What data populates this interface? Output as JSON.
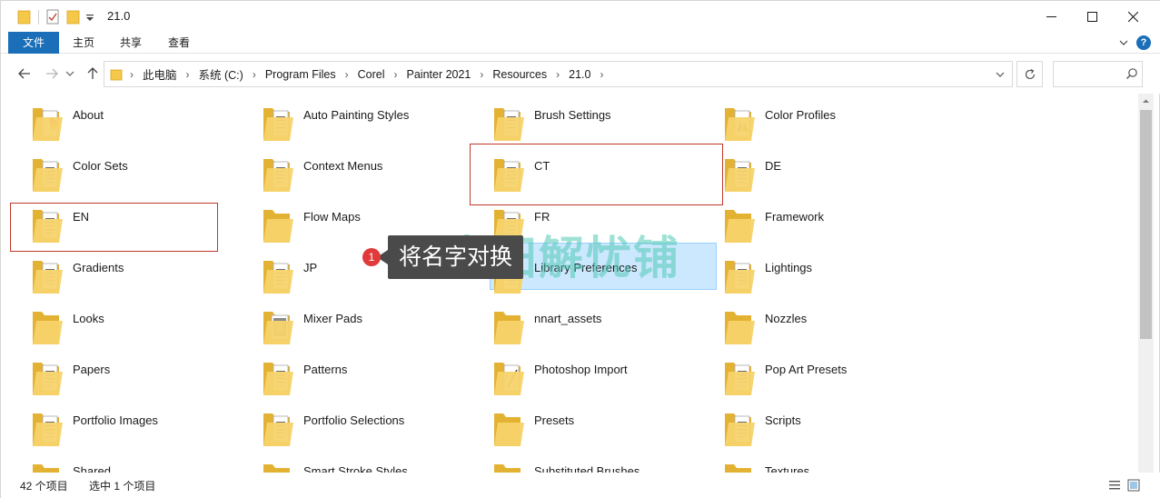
{
  "window": {
    "title": "21.0"
  },
  "ribbon": {
    "tabs": [
      "文件",
      "主页",
      "共享",
      "查看"
    ],
    "help_label": "?"
  },
  "address": {
    "crumbs": [
      "此电脑",
      "系统 (C:)",
      "Program Files",
      "Corel",
      "Painter 2021",
      "Resources",
      "21.0"
    ]
  },
  "search": {
    "placeholder": ""
  },
  "items": [
    {
      "label": "About",
      "icon": "folder-content-icon"
    },
    {
      "label": "Auto Painting Styles",
      "icon": "folder-doc-icon"
    },
    {
      "label": "Brush Settings",
      "icon": "folder-doc-icon"
    },
    {
      "label": "Color Profiles",
      "icon": "folder-color-icon"
    },
    {
      "label": "Color Sets",
      "icon": "folder-doc-icon"
    },
    {
      "label": "Context Menus",
      "icon": "folder-doc-icon"
    },
    {
      "label": "CT",
      "icon": "folder-doc-icon"
    },
    {
      "label": "DE",
      "icon": "folder-doc-icon"
    },
    {
      "label": "EN",
      "icon": "folder-doc-icon"
    },
    {
      "label": "Flow Maps",
      "icon": "folder-icon"
    },
    {
      "label": "FR",
      "icon": "folder-doc-icon"
    },
    {
      "label": "Framework",
      "icon": "folder-icon"
    },
    {
      "label": "Gradients",
      "icon": "folder-doc-icon"
    },
    {
      "label": "JP",
      "icon": "folder-doc-icon"
    },
    {
      "label": "Library Preferences",
      "icon": "folder-doc-icon"
    },
    {
      "label": "Lightings",
      "icon": "folder-doc-icon"
    },
    {
      "label": "Looks",
      "icon": "folder-icon"
    },
    {
      "label": "Mixer Pads",
      "icon": "folder-image-icon"
    },
    {
      "label": "nnart_assets",
      "icon": "folder-icon"
    },
    {
      "label": "Nozzles",
      "icon": "folder-icon"
    },
    {
      "label": "Papers",
      "icon": "folder-doc-icon"
    },
    {
      "label": "Patterns",
      "icon": "folder-doc-icon"
    },
    {
      "label": "Photoshop Import",
      "icon": "folder-brush-icon"
    },
    {
      "label": "Pop Art Presets",
      "icon": "folder-doc-icon"
    },
    {
      "label": "Portfolio Images",
      "icon": "folder-doc-icon"
    },
    {
      "label": "Portfolio Selections",
      "icon": "folder-doc-icon"
    },
    {
      "label": "Presets",
      "icon": "folder-icon"
    },
    {
      "label": "Scripts",
      "icon": "folder-doc-icon"
    },
    {
      "label": "Shared",
      "icon": "folder-icon"
    },
    {
      "label": "Smart Stroke Styles",
      "icon": "folder-icon"
    },
    {
      "label": "Substituted Brushes",
      "icon": "folder-icon"
    },
    {
      "label": "Textures",
      "icon": "folder-icon"
    }
  ],
  "selected_item": "CT",
  "status": {
    "count": "42 个项目",
    "selection": "选中 1 个项目"
  },
  "annotation": {
    "badge": "1",
    "text": "将名字对换"
  },
  "watermark": {
    "text": "麦田解忧铺"
  },
  "colors": {
    "accent": "#1a6fb8",
    "selection_fill": "#cce8ff",
    "selection_border": "#99d1ff",
    "highlight_border": "#c0392b",
    "folder": "#f5c84a"
  }
}
